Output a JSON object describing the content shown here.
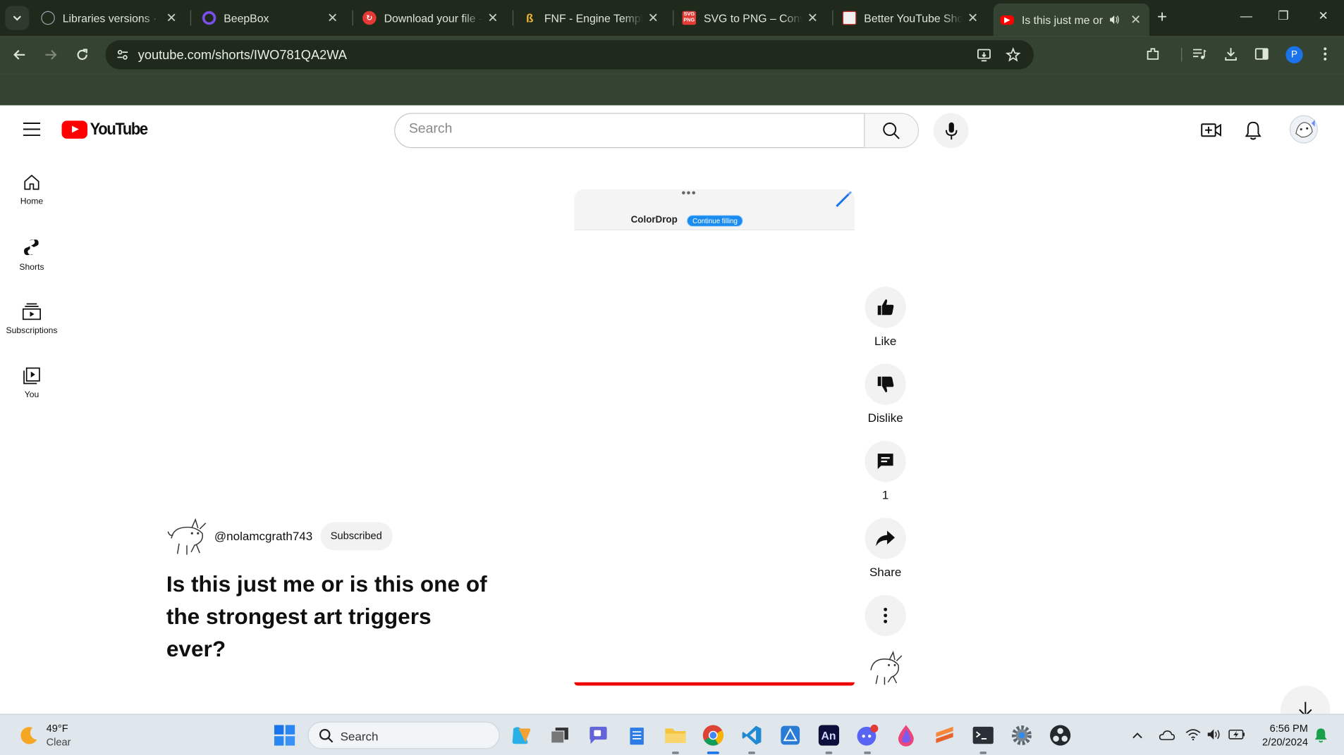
{
  "browser": {
    "tabs": [
      {
        "title": "Libraries versions · Sh",
        "icon": "github-icon"
      },
      {
        "title": "BeepBox",
        "icon": "beepbox-icon"
      },
      {
        "title": "Download your file – ",
        "icon": "download-site-icon"
      },
      {
        "title": "FNF - Engine Templat",
        "icon": "gamebanana-icon"
      },
      {
        "title": "SVG to PNG – Conve",
        "icon": "svg-png-icon"
      },
      {
        "title": "Better YouTube Shor",
        "icon": "extension-page-icon"
      },
      {
        "title": "Is this just me or",
        "icon": "youtube-icon",
        "active": true
      }
    ],
    "url_host": "youtube.com",
    "url_path": "/shorts/IWO781QA2WA"
  },
  "youtube": {
    "logo_text": "YouTube",
    "search_placeholder": "Search",
    "guide": [
      {
        "label": "Home"
      },
      {
        "label": "Shorts"
      },
      {
        "label": "Subscriptions"
      },
      {
        "label": "You"
      }
    ],
    "player": {
      "app_name": "ColorDrop",
      "cta": "Continue filling"
    },
    "actions": {
      "like": "Like",
      "dislike": "Dislike",
      "comments": "1",
      "share": "Share"
    },
    "channel": {
      "handle": "@nolamcgrath743",
      "subscribe_state": "Subscribed"
    },
    "title": "Is this just me or is this one of the strongest art triggers ever?"
  },
  "taskbar": {
    "weather_temp": "49°F",
    "weather_desc": "Clear",
    "search_label": "Search",
    "time": "6:56 PM",
    "date": "2/20/2024"
  },
  "colors": {
    "chrome_dark": "#1f2a1d",
    "chrome_toolbar": "#354333",
    "youtube_red": "#ff0000"
  }
}
